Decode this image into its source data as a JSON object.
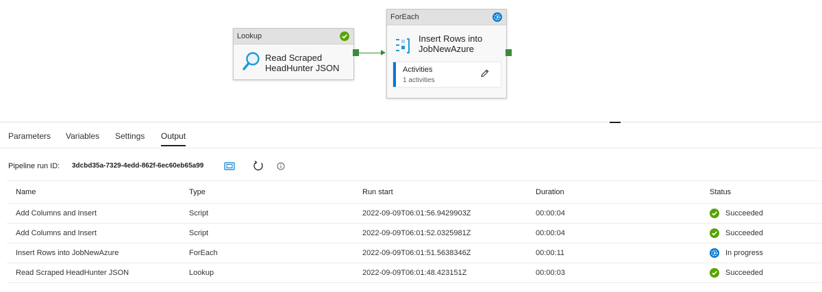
{
  "canvas": {
    "lookup": {
      "type_label": "Lookup",
      "title": "Read Scraped HeadHunter JSON",
      "status": "succeeded"
    },
    "foreach": {
      "type_label": "ForEach",
      "title": "Insert Rows into JobNewAzure",
      "status": "in-progress",
      "activities_label": "Activities",
      "activities_count": "1 activities"
    }
  },
  "tabs": [
    {
      "label": "Parameters",
      "active": false
    },
    {
      "label": "Variables",
      "active": false
    },
    {
      "label": "Settings",
      "active": false
    },
    {
      "label": "Output",
      "active": true
    }
  ],
  "output": {
    "run_id_label": "Pipeline run ID:",
    "run_id": "3dcbd35a-7329-4edd-862f-6ec60eb65a99",
    "columns": [
      "Name",
      "Type",
      "Run start",
      "Duration",
      "Status"
    ],
    "rows": [
      {
        "name": "Add Columns and Insert",
        "type": "Script",
        "run_start": "2022-09-09T06:01:56.9429903Z",
        "duration": "00:00:04",
        "status": "Succeeded",
        "status_icon": "check-circle-icon"
      },
      {
        "name": "Add Columns and Insert",
        "type": "Script",
        "run_start": "2022-09-09T06:01:52.0325981Z",
        "duration": "00:00:04",
        "status": "Succeeded",
        "status_icon": "check-circle-icon"
      },
      {
        "name": "Insert Rows into JobNewAzure",
        "type": "ForEach",
        "run_start": "2022-09-09T06:01:51.5638346Z",
        "duration": "00:00:11",
        "status": "In progress",
        "status_icon": "in-progress-icon"
      },
      {
        "name": "Read Scraped HeadHunter JSON",
        "type": "Lookup",
        "run_start": "2022-09-09T06:01:48.423151Z",
        "duration": "00:00:03",
        "status": "Succeeded",
        "status_icon": "check-circle-icon"
      }
    ]
  },
  "colors": {
    "success": "#57a300",
    "progress": "#0078d4",
    "connector": "#3c8a3c",
    "accent": "#0078d4"
  }
}
